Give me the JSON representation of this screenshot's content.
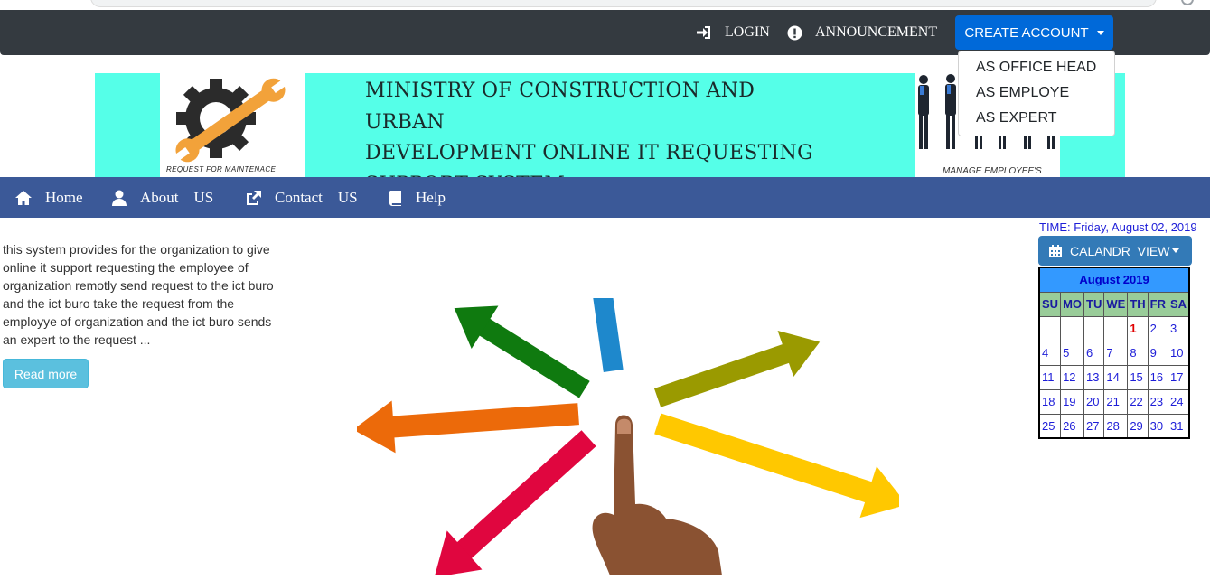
{
  "topbar": {
    "login_label": "LOGIN",
    "announcement_label": "ANNOUNCEMENT",
    "create_account_label": "CREATE ACCOUNT",
    "dropdown_items": [
      "AS OFFICE HEAD",
      "AS EMPLOYE",
      "AS EXPERT"
    ]
  },
  "banner": {
    "title_lines": [
      "MINISTRY OF CONSTRUCTION AND URBAN",
      "DEVELOPMENT ONLINE IT REQUESTING",
      "SUPPORT SYSTEM"
    ],
    "logo_caption": "REQUEST FOR MAINTENACE",
    "people_caption": "MANAGE EMPLOYEE'S"
  },
  "nav": {
    "home": "Home",
    "about_1": "About",
    "about_2": "US",
    "contact_1": "Contact",
    "contact_2": "US",
    "help": "Help"
  },
  "intro": {
    "text": "this system provides for the organization to give online it support requesting the employee of organization remotly send request to the ict buro and the ict buro take the request from the employye of organization and the ict buro sends an expert to the request ...",
    "read_more_label": "Read more"
  },
  "sidebar": {
    "time_text": "TIME: Friday, August 02, 2019",
    "calendar_button_label": "CALANDR  VIEW"
  },
  "calendar": {
    "month_label": "August 2019",
    "weekdays": [
      "SU",
      "MO",
      "TU",
      "WE",
      "TH",
      "FR",
      "SA"
    ],
    "weeks": [
      [
        "",
        "",
        "",
        "",
        "1",
        "2",
        "3"
      ],
      [
        "4",
        "5",
        "6",
        "7",
        "8",
        "9",
        "10"
      ],
      [
        "11",
        "12",
        "13",
        "14",
        "15",
        "16",
        "17"
      ],
      [
        "18",
        "19",
        "20",
        "21",
        "22",
        "23",
        "24"
      ],
      [
        "25",
        "26",
        "27",
        "28",
        "29",
        "30",
        "31"
      ]
    ],
    "highlight_day": "1"
  },
  "colors": {
    "topbar_bg": "#343a40",
    "nav_bg": "#3b5998",
    "banner_bg": "#55ffe8",
    "primary_button": "#0069d9",
    "info_button": "#5bc0de"
  },
  "icons": [
    "login-icon",
    "exclamation-circle-icon",
    "home-icon",
    "user-icon",
    "share-icon",
    "book-icon",
    "calendar-icon"
  ]
}
